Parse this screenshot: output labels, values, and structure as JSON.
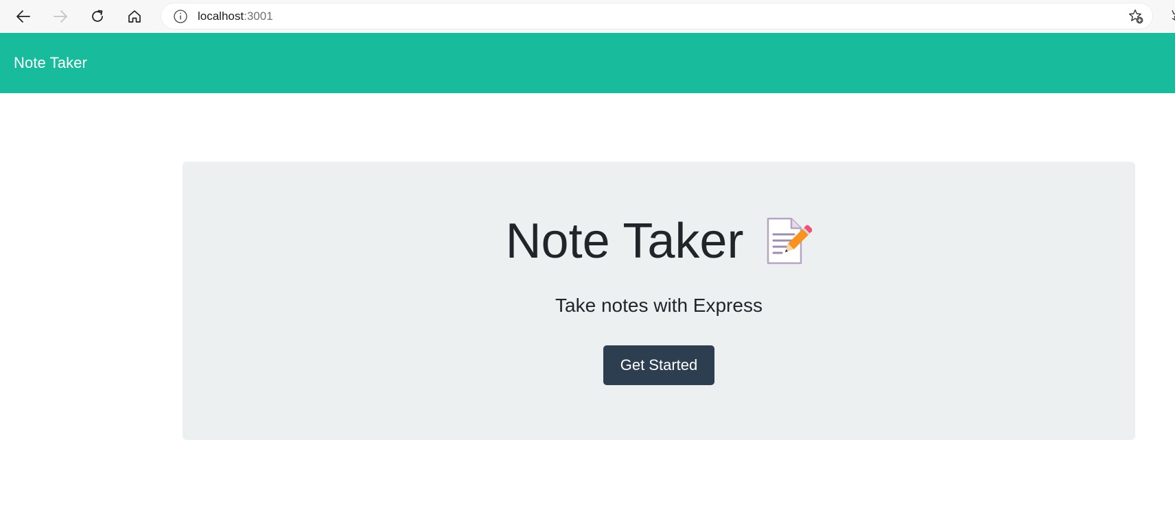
{
  "browser": {
    "url_host": "localhost",
    "url_port": ":3001",
    "icons": [
      "back-icon",
      "forward-icon",
      "refresh-icon",
      "home-icon",
      "info-icon",
      "add-favorite-icon"
    ]
  },
  "navbar": {
    "brand": "Note Taker",
    "color": "#18bc9c"
  },
  "jumbotron": {
    "title": "Note Taker",
    "emoji_icon": "memo-pencil-icon",
    "lead": "Take notes with Express",
    "button_label": "Get Started",
    "button_color": "#2c3e50",
    "background": "#ecf0f1"
  }
}
